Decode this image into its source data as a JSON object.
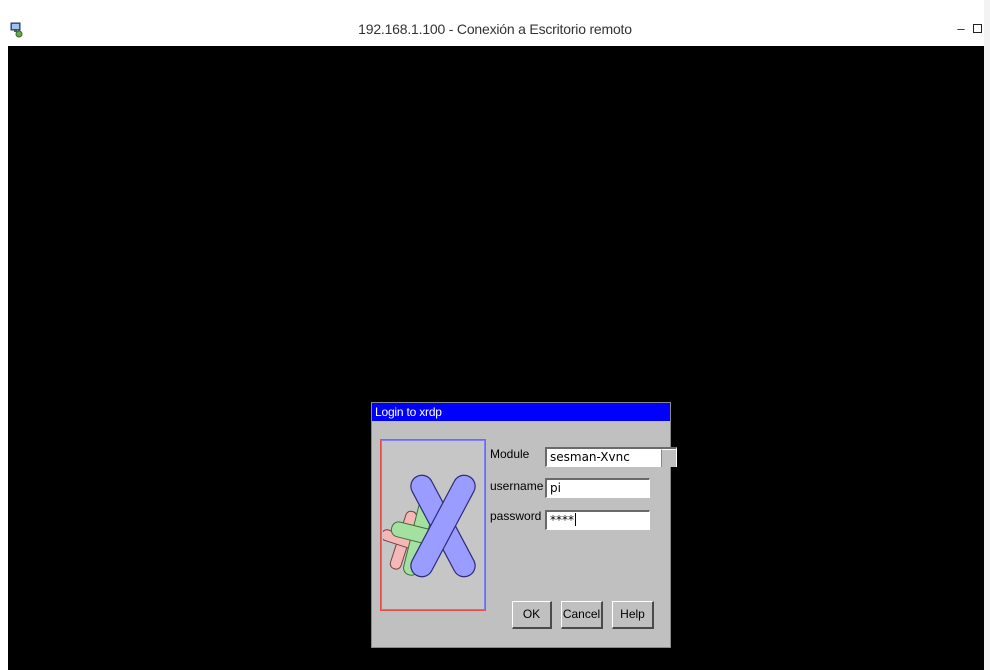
{
  "window": {
    "title": "192.168.1.100 - Conexión a Escritorio remoto",
    "minimize_label": "‒",
    "icons": [
      "remote-desktop-icon",
      "minimize-icon",
      "maximize-icon"
    ]
  },
  "dialog": {
    "title": "Login to xrdp",
    "logo": "xrdp-logo",
    "fields": {
      "module_label": "Module",
      "module_value": "sesman-Xvnc",
      "username_label": "username",
      "username_value": "pi",
      "password_label": "password",
      "password_value": "****"
    },
    "buttons": {
      "ok": "OK",
      "cancel": "Cancel",
      "help": "Help"
    }
  },
  "colors": {
    "remote_background": "#000000",
    "dialog_title_bar": "#0000ff",
    "dialog_background": "#c0c0c0"
  }
}
